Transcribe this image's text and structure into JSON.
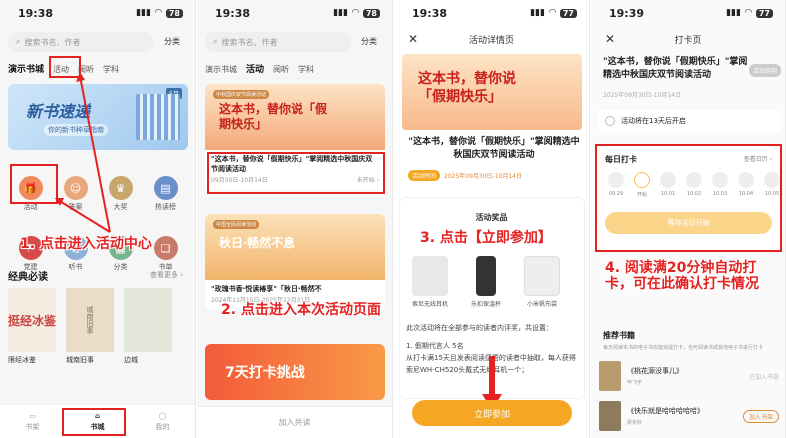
{
  "status": {
    "time1": "19:38",
    "time2": "19:38",
    "time3": "19:38",
    "time4": "19:39",
    "battery1": "78",
    "battery2": "78",
    "battery3": "77",
    "battery4": "77"
  },
  "panel1": {
    "search_placeholder": "搜索书名、作者",
    "category": "分类",
    "tabs": [
      "演示书城",
      "活动",
      "阅听",
      "学科"
    ],
    "banner_title": "新书速递",
    "banner_sub": "你的新书种草指南",
    "banner_badge": "5月",
    "icons": [
      {
        "label": "活动",
        "color": "#f08a5d"
      },
      {
        "label": "答案",
        "color": "#e8a87c"
      },
      {
        "label": "大奖",
        "color": "#c9a66b"
      },
      {
        "label": "热读榜",
        "color": "#6b8fc9"
      },
      {
        "label": "党建",
        "color": "#d94b4b"
      },
      {
        "label": "听书",
        "color": "#8fb0d8"
      },
      {
        "label": "分类",
        "color": "#79b48f"
      },
      {
        "label": "书单",
        "color": "#c97b6b"
      }
    ],
    "section_title": "经典必读",
    "section_more": "查看更多 ›",
    "books": [
      {
        "title": "限经冰鉴",
        "cover_text": "挺经冰鉴",
        "color": "#f4ece0"
      },
      {
        "title": "城南旧事",
        "cover_text": "城南旧事",
        "color": "#e9ddc9"
      },
      {
        "title": "边城",
        "cover_text": "",
        "color": "#e2e6d8"
      }
    ],
    "tabbar": [
      "书架",
      "书城",
      "我的"
    ],
    "annotation": "1. 点击进入活动中心"
  },
  "panel2": {
    "tabs": [
      "演示书城",
      "活动",
      "阅听",
      "学科"
    ],
    "card1": {
      "tag": "中秋国庆双节阅读活动",
      "big": "这本书，替你说「假期快乐」",
      "title": "\"这本书，替你说「假期快乐」\"掌阅精选中秋国庆双节阅读活动",
      "date": "09月30日-10月14日",
      "status": "未开始 ›"
    },
    "card2": {
      "tag": "中国全民阅读活动",
      "big": "秋日·畅然不息",
      "title": "\"玫瑰书香·悦读椿享\"「秋日·畅然不",
      "date": "2024年11月15日-2025年12月31日"
    },
    "card3": {
      "big": "7天打卡挑战"
    },
    "join": "加入共读",
    "annotation": "2. 点击进入本次活动页面"
  },
  "panel3": {
    "nav_title": "活动详情页",
    "banner_big": "这本书，替你说「假期快乐」",
    "title": "\"这本书，替你说「假期快乐」\"掌阅精选中秋国庆双节阅读活动",
    "meta_badge": "活动时间",
    "meta_time": "2025年09月30日-10月14日",
    "prize_title": "活动奖品",
    "prizes": [
      {
        "name": "索尼无线耳机",
        "color": "#e8e8e8"
      },
      {
        "name": "乐扣保温杯",
        "color": "#333333"
      },
      {
        "name": "小米帆布袋",
        "color": "#eeeeee"
      }
    ],
    "rules": [
      "此次活动将在全部参与的读者内评奖，共设置：",
      "",
      "1. 假期代言人 5名",
      "从打卡满15天且发表阅读感悟的读者中抽取，每人获得索尼WH-CH520头戴式无线耳机一个；"
    ],
    "button": "立即参加",
    "annotation": "3. 点击【立即参加】"
  },
  "panel4": {
    "nav_title": "打卡页",
    "title": "\"这本书，替你说「假期快乐」\"掌阅精选中秋国庆双节阅读活动",
    "end_badge": "活动说明",
    "date": "2025年09月30日-10月14日",
    "start_notice": "活动将在13天后开启",
    "checkin_title": "每日打卡",
    "checkin_record": "查看日历 ›",
    "days": [
      "09.29",
      "开始",
      "10.01",
      "10.02",
      "10.03",
      "10.04",
      "10.05"
    ],
    "checkin_button": "等待活动开始",
    "rec_title": "推荐书籍",
    "rec_sub": "每天阅读本书的电子书仅能完成打卡，也可阅读书城其他电子书进行打卡",
    "rec_books": [
      {
        "title": "《桃花源没事儿》",
        "author": "毕飞宇",
        "status": "已加入书架",
        "color": "#b89a6c"
      },
      {
        "title": "《快乐就是哈哈哈哈哈》",
        "author": "梁实秋",
        "status": "加入书架",
        "color": "#8d7b5c"
      }
    ],
    "annotation": "4. 阅读满20分钟自动打卡，可在此确认打卡情况"
  }
}
